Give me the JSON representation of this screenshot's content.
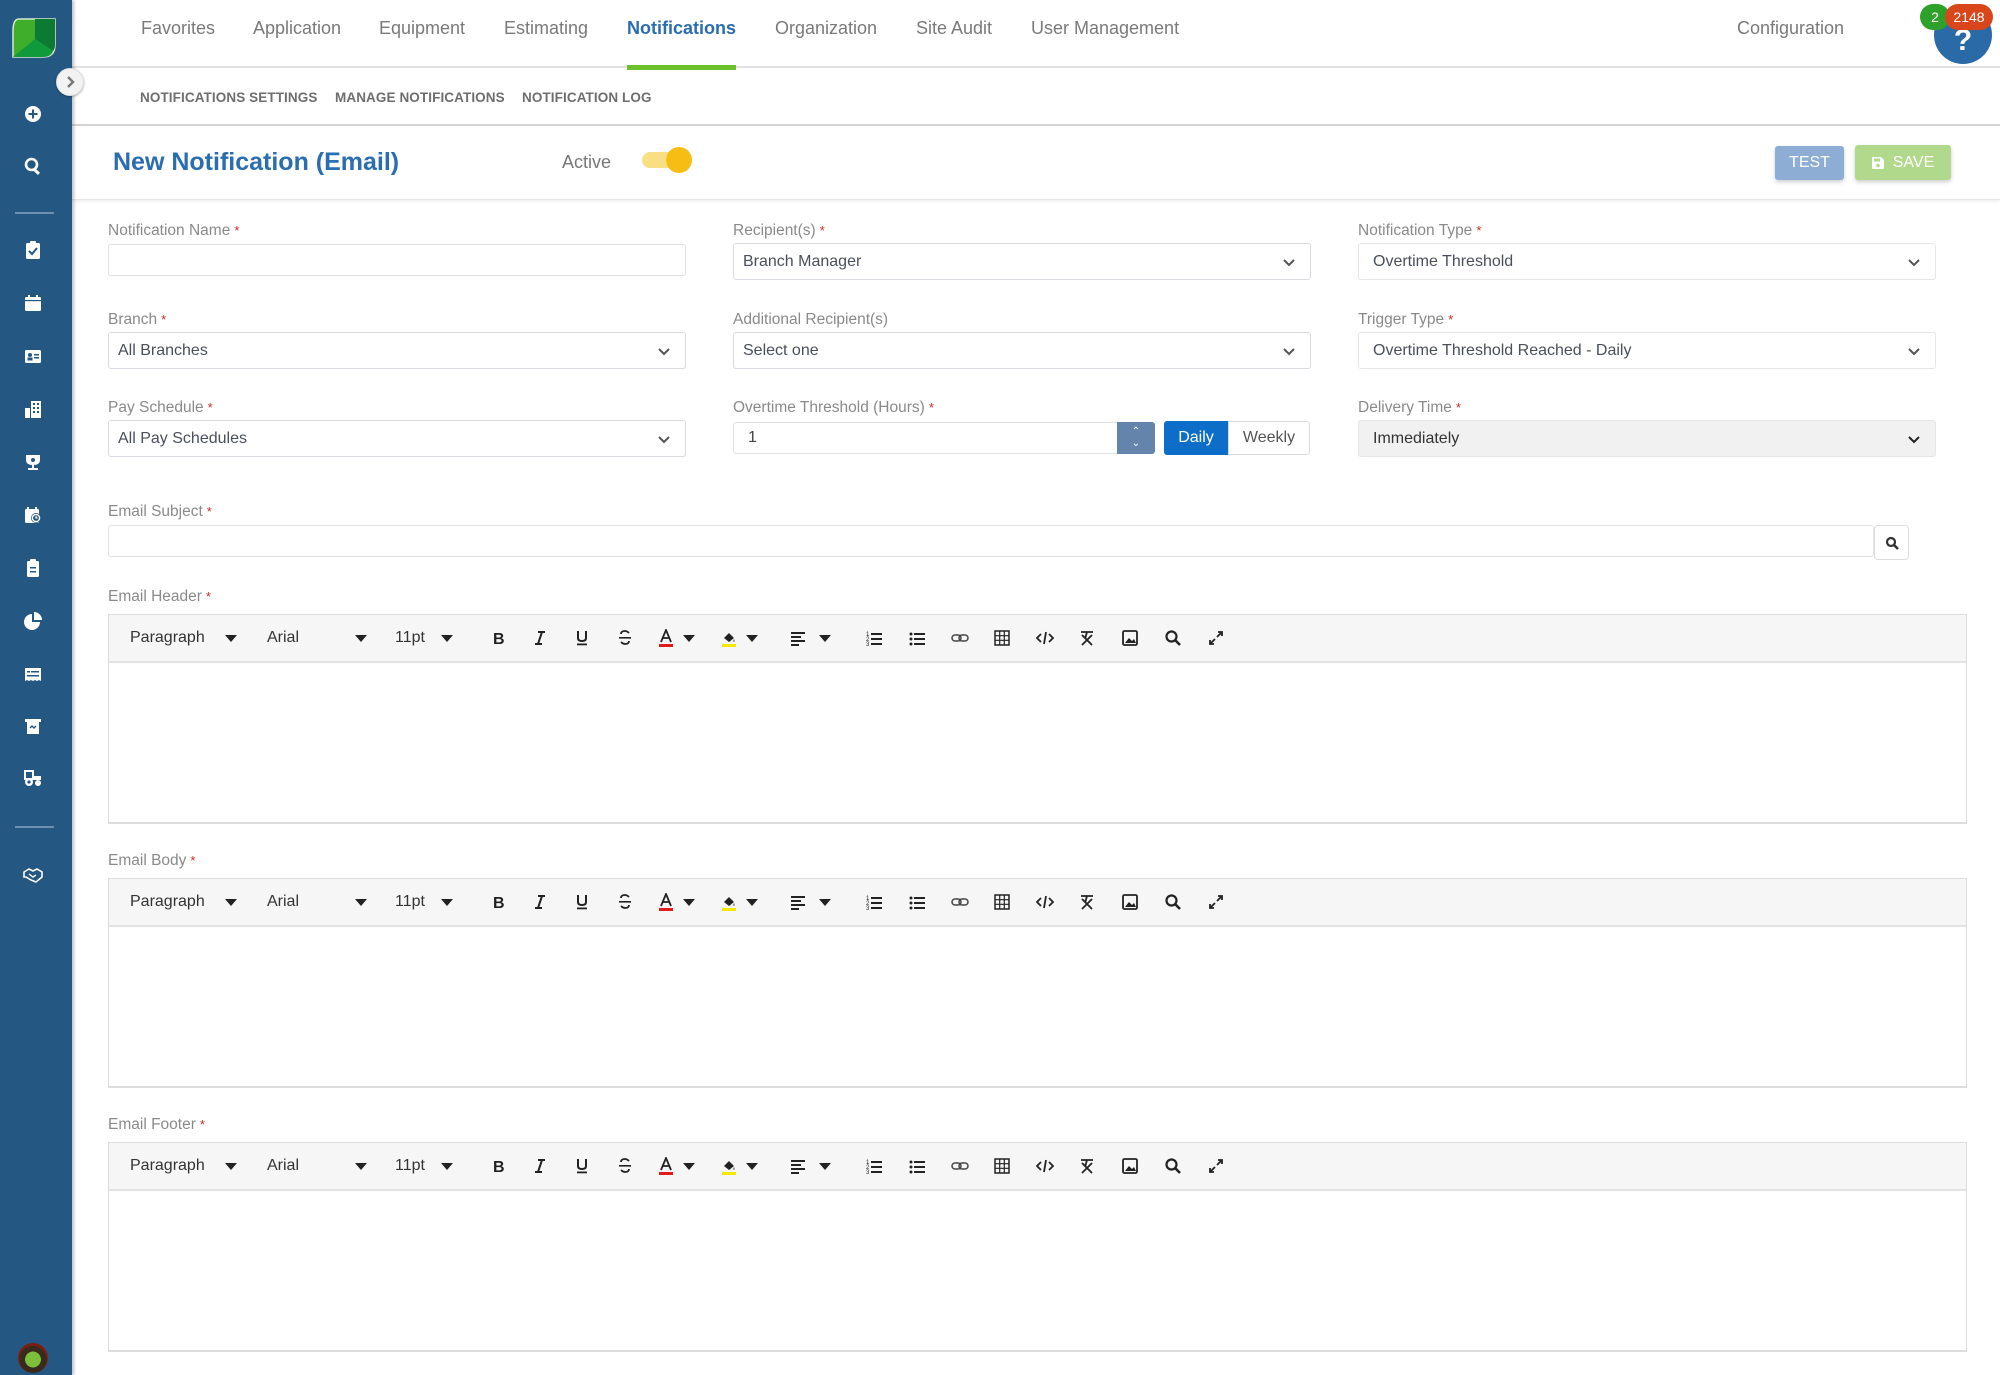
{
  "sidebar": {
    "items": [
      {
        "icon": "plus-circle-icon"
      },
      {
        "icon": "search-icon"
      },
      {
        "icon": "clipboard-check-icon"
      },
      {
        "icon": "calendar-icon"
      },
      {
        "icon": "id-card-icon"
      },
      {
        "icon": "buildings-icon"
      },
      {
        "icon": "trophy-icon"
      },
      {
        "icon": "calendar-clock-icon"
      },
      {
        "icon": "clipboard-list-icon"
      },
      {
        "icon": "pie-chart-icon"
      },
      {
        "icon": "receipt-icon"
      },
      {
        "icon": "cash-register-icon"
      },
      {
        "icon": "tractor-icon"
      },
      {
        "icon": "handshake-icon"
      }
    ]
  },
  "topnav": {
    "tabs": [
      {
        "label": "Favorites",
        "active": false
      },
      {
        "label": "Application",
        "active": false
      },
      {
        "label": "Equipment",
        "active": false
      },
      {
        "label": "Estimating",
        "active": false
      },
      {
        "label": "Notifications",
        "active": true
      },
      {
        "label": "Organization",
        "active": false
      },
      {
        "label": "Site Audit",
        "active": false
      },
      {
        "label": "User Management",
        "active": false
      }
    ],
    "configuration": "Configuration",
    "help_icon": "?",
    "badge_green": "2",
    "badge_red": "2148",
    "accent_color": "#6cc12b"
  },
  "subnav": {
    "items": [
      "NOTIFICATIONS SETTINGS",
      "MANAGE NOTIFICATIONS",
      "NOTIFICATION LOG"
    ]
  },
  "header": {
    "title": "New Notification (Email)",
    "active_label": "Active",
    "active_on": true,
    "test_label": "TEST",
    "save_label": "SAVE"
  },
  "form": {
    "notification_name": {
      "label": "Notification Name",
      "value": ""
    },
    "recipients": {
      "label": "Recipient(s)",
      "value": "Branch Manager"
    },
    "notification_type": {
      "label": "Notification Type",
      "value": "Overtime Threshold"
    },
    "branch": {
      "label": "Branch",
      "value": "All Branches"
    },
    "additional_recipients": {
      "label": "Additional Recipient(s)",
      "value": "Select one"
    },
    "trigger_type": {
      "label": "Trigger Type",
      "value": "Overtime Threshold Reached - Daily"
    },
    "pay_schedule": {
      "label": "Pay Schedule",
      "value": "All Pay Schedules"
    },
    "overtime_threshold": {
      "label": "Overtime Threshold (Hours)",
      "value": "1",
      "period_options": [
        "Daily",
        "Weekly"
      ],
      "period_selected": "Daily"
    },
    "delivery_time": {
      "label": "Delivery Time",
      "value": "Immediately"
    },
    "email_subject": {
      "label": "Email Subject",
      "value": ""
    },
    "required_mark": "*"
  },
  "editors": [
    {
      "label": "Email Header"
    },
    {
      "label": "Email Body"
    },
    {
      "label": "Email Footer"
    }
  ],
  "editor_toolbar": {
    "block_format": "Paragraph",
    "font_family": "Arial",
    "font_size": "11pt",
    "text_color": "#e01b1b",
    "highlight_color": "#f5e800"
  }
}
